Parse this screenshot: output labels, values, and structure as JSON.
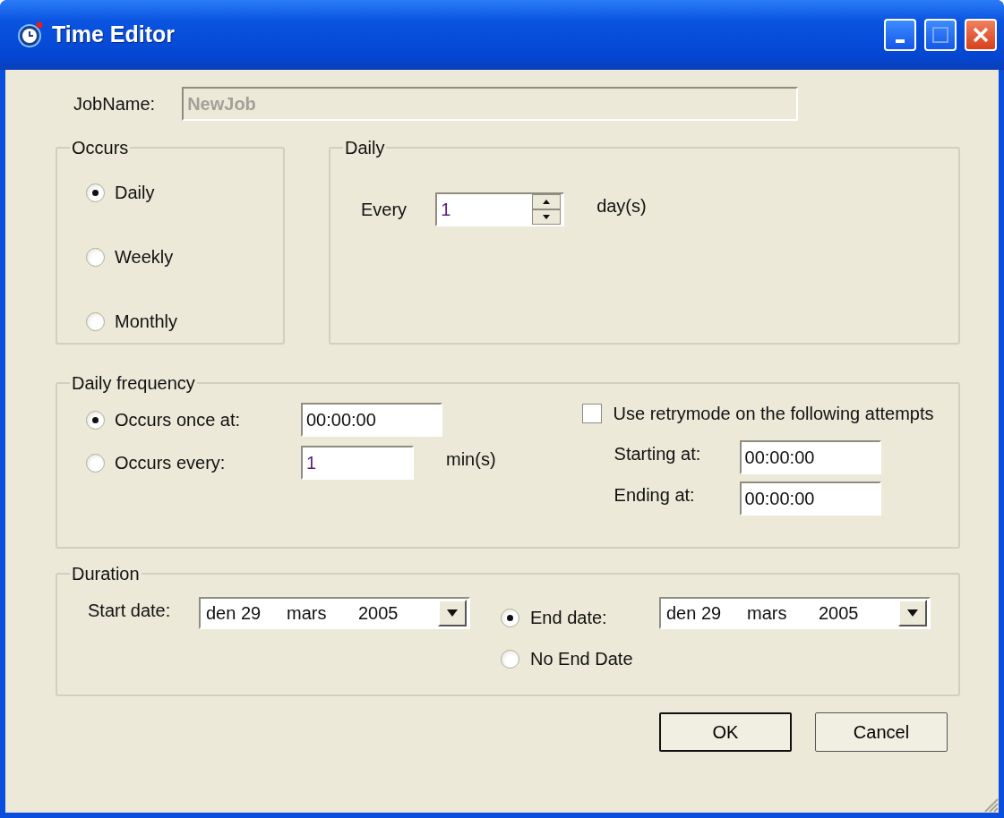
{
  "window": {
    "title": "Time Editor"
  },
  "job_name": {
    "label": "JobName:",
    "value": "NewJob",
    "disabled": true
  },
  "occurs": {
    "title": "Occurs",
    "options": [
      {
        "label": "Daily",
        "selected": true
      },
      {
        "label": "Weekly",
        "selected": false
      },
      {
        "label": "Monthly",
        "selected": false
      }
    ]
  },
  "daily": {
    "title": "Daily",
    "every_label": "Every",
    "every_value": "1",
    "unit": "day(s)"
  },
  "daily_frequency": {
    "title": "Daily frequency",
    "options": [
      {
        "label": "Occurs once at:",
        "selected": true,
        "value": "00:00:00"
      },
      {
        "label": "Occurs every:",
        "selected": false,
        "value": "1",
        "unit": "min(s)"
      }
    ],
    "retry": {
      "label": "Use retrymode on the following attempts",
      "checked": false
    },
    "starting": {
      "label": "Starting at:",
      "value": "00:00:00"
    },
    "ending": {
      "label": "Ending at:",
      "value": "00:00:00"
    }
  },
  "duration": {
    "title": "Duration",
    "start": {
      "label": "Start date:",
      "segments": [
        "den 29",
        "mars",
        "2005"
      ]
    },
    "end_options": [
      {
        "label": "End date:",
        "selected": true
      },
      {
        "label": "No End Date",
        "selected": false
      }
    ],
    "end_date": {
      "segments": [
        "den 29",
        "mars",
        "2005"
      ]
    }
  },
  "buttons": [
    {
      "label": "OK",
      "default": true
    },
    {
      "label": "Cancel",
      "default": false
    }
  ]
}
